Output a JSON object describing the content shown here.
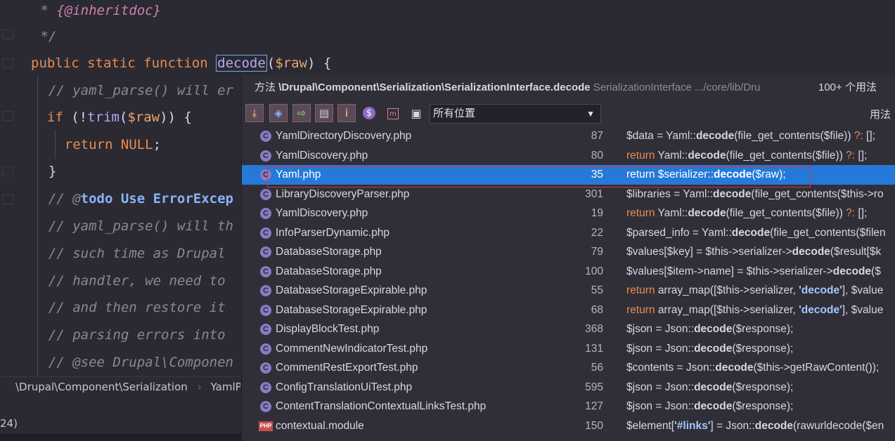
{
  "editor": {
    "lines": [
      {
        "type": "comment_tag",
        "prefix": " * ",
        "tag": "{@inheritdoc}"
      },
      {
        "type": "comment",
        "text": " */"
      },
      {
        "type": "signature",
        "kw": "public static function",
        "fn": "decode",
        "arg": "($raw) {"
      },
      {
        "type": "comment",
        "text": "  // yaml_parse() will er"
      },
      {
        "type": "if",
        "kw": "if",
        "rest": "(!trim($raw)) {"
      },
      {
        "type": "return",
        "kw": "return",
        "cnst": "NULL",
        "end": ";"
      },
      {
        "type": "plain",
        "text": "  }"
      },
      {
        "type": "todo",
        "prefix": "  // @",
        "todo": "todo Use ErrorExcep"
      },
      {
        "type": "comment",
        "text": "  // yaml_parse() will th"
      },
      {
        "type": "comment",
        "text": "  // such time as Drupal"
      },
      {
        "type": "comment",
        "text": "  // handler, we need to"
      },
      {
        "type": "comment",
        "text": "  // and then restore it"
      },
      {
        "type": "comment",
        "text": "  // parsing errors into"
      },
      {
        "type": "comment",
        "text": "  // @see Drupal\\Componen"
      }
    ],
    "breadcrumb": [
      "\\Drupal\\Component\\Serialization",
      "YamlPe"
    ],
    "status_left": "24)"
  },
  "popup": {
    "header": {
      "method_label": "方法",
      "method_path": "\\Drupal\\Component\\Serialization\\SerializationInterface.decode",
      "context": "SerializationInterface .../core/lib/Dru",
      "count": "100+ 个用法"
    },
    "toolbar": {
      "buttons": [
        "merge-icon",
        "navigate-icon",
        "goto-icon",
        "settings-folder-icon",
        "info-icon"
      ],
      "scope": "所有位置",
      "usage_label": "用法"
    },
    "results": [
      {
        "icon": "class",
        "file": "YamlDirectoryDiscovery.php",
        "line": "87",
        "code": [
          {
            "t": "v",
            "s": "$data = Yaml::"
          },
          {
            "t": "b",
            "s": "decode"
          },
          {
            "t": "v",
            "s": "(file_get_contents($file)) "
          },
          {
            "t": "k",
            "s": "?: "
          },
          {
            "t": "v",
            "s": "[];"
          }
        ]
      },
      {
        "icon": "class",
        "file": "YamlDiscovery.php",
        "line": "80",
        "code": [
          {
            "t": "k",
            "s": "return "
          },
          {
            "t": "v",
            "s": "Yaml::"
          },
          {
            "t": "b",
            "s": "decode"
          },
          {
            "t": "v",
            "s": "(file_get_contents($file)) "
          },
          {
            "t": "k",
            "s": "?: "
          },
          {
            "t": "v",
            "s": "[];"
          }
        ]
      },
      {
        "icon": "class",
        "file": "Yaml.php",
        "line": "35",
        "selected": true,
        "code": [
          {
            "t": "v",
            "s": "return $serializer::"
          },
          {
            "t": "b",
            "s": "decode"
          },
          {
            "t": "v",
            "s": "($raw);"
          }
        ]
      },
      {
        "icon": "class",
        "file": "LibraryDiscoveryParser.php",
        "line": "301",
        "code": [
          {
            "t": "v",
            "s": "$libraries = Yaml::"
          },
          {
            "t": "b",
            "s": "decode"
          },
          {
            "t": "v",
            "s": "(file_get_contents($this->ro"
          }
        ]
      },
      {
        "icon": "class",
        "file": "YamlDiscovery.php",
        "line": "19",
        "code": [
          {
            "t": "k",
            "s": "return "
          },
          {
            "t": "v",
            "s": "Yaml::"
          },
          {
            "t": "b",
            "s": "decode"
          },
          {
            "t": "v",
            "s": "(file_get_contents($file)) "
          },
          {
            "t": "k",
            "s": "?: "
          },
          {
            "t": "v",
            "s": "[];"
          }
        ]
      },
      {
        "icon": "class",
        "file": "InfoParserDynamic.php",
        "line": "22",
        "code": [
          {
            "t": "v",
            "s": "$parsed_info = Yaml::"
          },
          {
            "t": "b",
            "s": "decode"
          },
          {
            "t": "v",
            "s": "(file_get_contents($filen"
          }
        ]
      },
      {
        "icon": "class",
        "file": "DatabaseStorage.php",
        "line": "79",
        "code": [
          {
            "t": "v",
            "s": "$values[$key] = $this->serializer->"
          },
          {
            "t": "b",
            "s": "decode"
          },
          {
            "t": "v",
            "s": "($result[$k"
          }
        ]
      },
      {
        "icon": "class",
        "file": "DatabaseStorage.php",
        "line": "100",
        "code": [
          {
            "t": "v",
            "s": "$values[$item->name] = $this->serializer->"
          },
          {
            "t": "b",
            "s": "decode"
          },
          {
            "t": "v",
            "s": "($"
          }
        ]
      },
      {
        "icon": "class",
        "file": "DatabaseStorageExpirable.php",
        "line": "55",
        "code": [
          {
            "t": "k",
            "s": "return "
          },
          {
            "t": "v",
            "s": "array_map([$this->serializer, "
          },
          {
            "t": "s",
            "s": "'decode'"
          },
          {
            "t": "v",
            "s": "], $value"
          }
        ]
      },
      {
        "icon": "class",
        "file": "DatabaseStorageExpirable.php",
        "line": "68",
        "code": [
          {
            "t": "k",
            "s": "return "
          },
          {
            "t": "v",
            "s": "array_map([$this->serializer, "
          },
          {
            "t": "s",
            "s": "'decode'"
          },
          {
            "t": "v",
            "s": "], $value"
          }
        ]
      },
      {
        "icon": "class",
        "file": "DisplayBlockTest.php",
        "line": "368",
        "code": [
          {
            "t": "v",
            "s": "$json = Json::"
          },
          {
            "t": "b",
            "s": "decode"
          },
          {
            "t": "v",
            "s": "($response);"
          }
        ]
      },
      {
        "icon": "class",
        "file": "CommentNewIndicatorTest.php",
        "line": "131",
        "code": [
          {
            "t": "v",
            "s": "$json = Json::"
          },
          {
            "t": "b",
            "s": "decode"
          },
          {
            "t": "v",
            "s": "($response);"
          }
        ]
      },
      {
        "icon": "class",
        "file": "CommentRestExportTest.php",
        "line": "56",
        "code": [
          {
            "t": "v",
            "s": "$contents = Json::"
          },
          {
            "t": "b",
            "s": "decode"
          },
          {
            "t": "v",
            "s": "($this->getRawContent());"
          }
        ]
      },
      {
        "icon": "class",
        "file": "ConfigTranslationUiTest.php",
        "line": "595",
        "code": [
          {
            "t": "v",
            "s": "$json = Json::"
          },
          {
            "t": "b",
            "s": "decode"
          },
          {
            "t": "v",
            "s": "($response);"
          }
        ]
      },
      {
        "icon": "class",
        "file": "ContentTranslationContextualLinksTest.php",
        "line": "127",
        "code": [
          {
            "t": "v",
            "s": "$json = Json::"
          },
          {
            "t": "b",
            "s": "decode"
          },
          {
            "t": "v",
            "s": "($response);"
          }
        ]
      },
      {
        "icon": "php",
        "file": "contextual.module",
        "line": "150",
        "code": [
          {
            "t": "v",
            "s": "$element["
          },
          {
            "t": "s",
            "s": "'#links'"
          },
          {
            "t": "v",
            "s": "] = Json::"
          },
          {
            "t": "b",
            "s": "decode"
          },
          {
            "t": "v",
            "s": "(rawurldecode($en"
          }
        ]
      }
    ]
  },
  "colors": {
    "accent": "#2479d9",
    "highlight_border": "#d9343a",
    "background": "#2b2a33"
  }
}
